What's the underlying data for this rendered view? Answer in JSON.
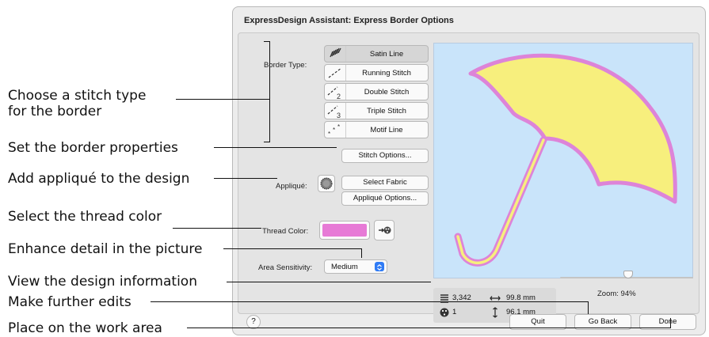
{
  "dialog": {
    "title": "ExpressDesign Assistant: Express Border Options"
  },
  "callouts": [
    "Choose a stitch type\nfor the border",
    "Set the border properties",
    "Add appliqué to the design",
    "Select the thread color",
    "Enhance detail in the picture",
    "View the design information",
    "Make further edits",
    "Place on the work area"
  ],
  "border_type": {
    "label": "Border Type:",
    "options": [
      "Satin Line",
      "Running Stitch",
      "Double Stitch",
      "Triple Stitch",
      "Motif Line"
    ],
    "selected": "Satin Line",
    "stitch_options_button": "Stitch Options..."
  },
  "applique": {
    "label": "Appliqué:",
    "select_fabric_button": "Select Fabric",
    "options_button": "Appliqué Options..."
  },
  "thread_color": {
    "label": "Thread Color:",
    "swatch_color": "#e77ad6"
  },
  "area_sensitivity": {
    "label": "Area Sensitivity:",
    "value": "Medium"
  },
  "design_info": {
    "stitches": "3,342",
    "colors": "1",
    "width": "99.8 mm",
    "height": "96.1 mm"
  },
  "zoom": {
    "label": "Zoom: 94%",
    "level": 0.94
  },
  "buttons": {
    "help": "?",
    "quit": "Quit",
    "go_back": "Go Back",
    "done": "Done"
  },
  "colors": {
    "preview_bg": "#c9e4fa",
    "umbrella_fill": "#f7ef7d",
    "outline": "#dd84d8"
  }
}
